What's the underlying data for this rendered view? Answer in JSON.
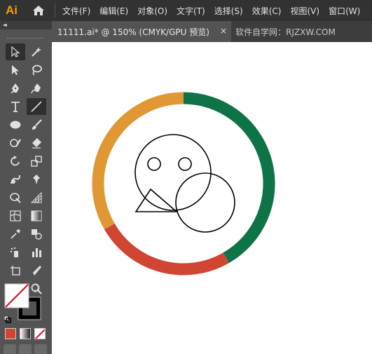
{
  "app": {
    "logo": "Ai"
  },
  "menu": [
    {
      "label": "文件(F)"
    },
    {
      "label": "编辑(E)"
    },
    {
      "label": "对象(O)"
    },
    {
      "label": "文字(T)"
    },
    {
      "label": "选择(S)"
    },
    {
      "label": "效果(C)"
    },
    {
      "label": "视图(V)"
    },
    {
      "label": "窗口(W)"
    }
  ],
  "tabs": {
    "active": {
      "title": "11111.ai* @ 150% (CMYK/GPU 预览)",
      "close": "×"
    },
    "inactive": {
      "title": "软件自学网：RJZXW.COM"
    }
  },
  "tools": [
    "selection-tool",
    "direct-selection-tool",
    "direct-select-tool",
    "curvature-tool",
    "pen-tool",
    "anchor-tool",
    "type-tool",
    "line-segment-tool",
    "ellipse-tool",
    "paintbrush-tool",
    "shaper-tool",
    "eraser-tool",
    "rotate-tool",
    "scale-tool",
    "warp-tool",
    "puppet-warp-tool",
    "shape-builder-tool",
    "perspective-grid-tool",
    "mesh-tool",
    "gradient-tool",
    "eyedropper-tool",
    "blend-tool",
    "symbol-sprayer-tool",
    "column-graph-tool",
    "artboard-tool",
    "slice-tool",
    "hand-tool",
    "zoom-tool"
  ],
  "colors": {
    "ring_orange": "#E09834",
    "ring_green": "#0E7447",
    "ring_red": "#D04632",
    "fill_none_slash": "#e8001c",
    "accent": "#ff9a00"
  }
}
